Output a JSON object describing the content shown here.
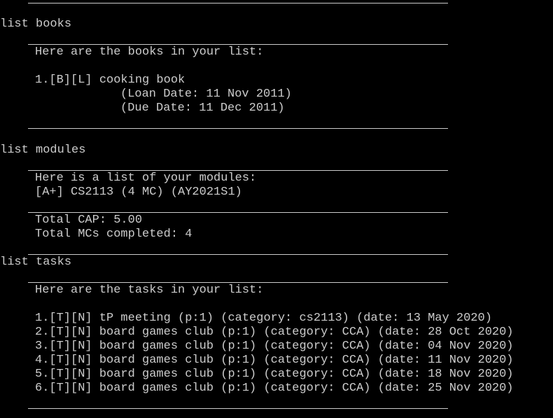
{
  "window": {
    "title": "",
    "colors": {
      "background": "#000000",
      "text": "#cccccc",
      "rule": "#cccccc"
    }
  },
  "output": {
    "books": {
      "command": "list books",
      "header": "Here are the books in your list:",
      "items": [
        {
          "line": "1.[B][L] cooking book",
          "loan": "(Loan Date: 11 Nov 2011)",
          "due": "(Due Date: 11 Dec 2011)"
        }
      ]
    },
    "modules": {
      "command": "list modules",
      "header": "Here is a list of your modules:",
      "items": [
        "[A+] CS2113 (4 MC) (AY2021S1)"
      ],
      "total_cap": "Total CAP: 5.00",
      "total_mcs": "Total MCs completed: 4"
    },
    "tasks": {
      "command": "list tasks",
      "header": "Here are the tasks in your list:",
      "items": [
        "1.[T][N] tP meeting (p:1) (category: cs2113) (date: 13 May 2020)",
        "2.[T][N] board games club (p:1) (category: CCA) (date: 28 Oct 2020)",
        "3.[T][N] board games club (p:1) (category: CCA) (date: 04 Nov 2020)",
        "4.[T][N] board games club (p:1) (category: CCA) (date: 11 Nov 2020)",
        "5.[T][N] board games club (p:1) (category: CCA) (date: 18 Nov 2020)",
        "6.[T][N] board games club (p:1) (category: CCA) (date: 25 Nov 2020)"
      ]
    }
  }
}
